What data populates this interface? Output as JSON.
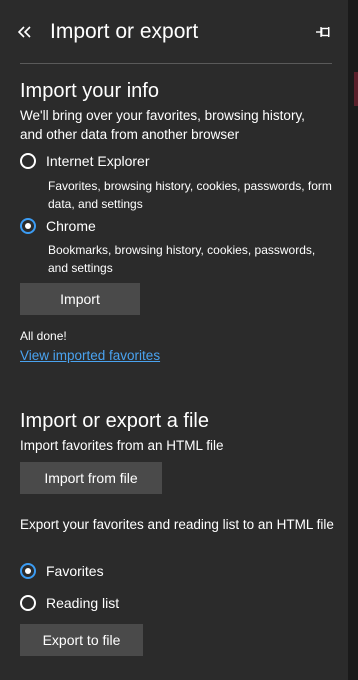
{
  "header": {
    "title": "Import or export",
    "back_icon": "double-chevron-left-icon",
    "pin_icon": "pin-icon"
  },
  "import_info": {
    "heading": "Import your info",
    "description": "We'll bring over your favorites, browsing history, and other data from another browser",
    "options": [
      {
        "label": "Internet Explorer",
        "description": "Favorites, browsing history, cookies, passwords, form data, and settings",
        "checked": false
      },
      {
        "label": "Chrome",
        "description": "Bookmarks, browsing history, cookies, passwords, and settings",
        "checked": true
      }
    ],
    "import_button": "Import",
    "status": "All done!",
    "view_link": "View imported favorites"
  },
  "file_section": {
    "heading": "Import or export a file",
    "import_description": "Import favorites from an HTML file",
    "import_button": "Import from file",
    "export_description": "Export your favorites and reading list to an HTML file",
    "export_options": [
      {
        "label": "Favorites",
        "checked": true
      },
      {
        "label": "Reading list",
        "checked": false
      }
    ],
    "export_button": "Export to file"
  },
  "colors": {
    "background": "#2b2b2b",
    "accent": "#3b9cf4",
    "link": "#4aa3f0",
    "button": "#4a4a4a"
  }
}
